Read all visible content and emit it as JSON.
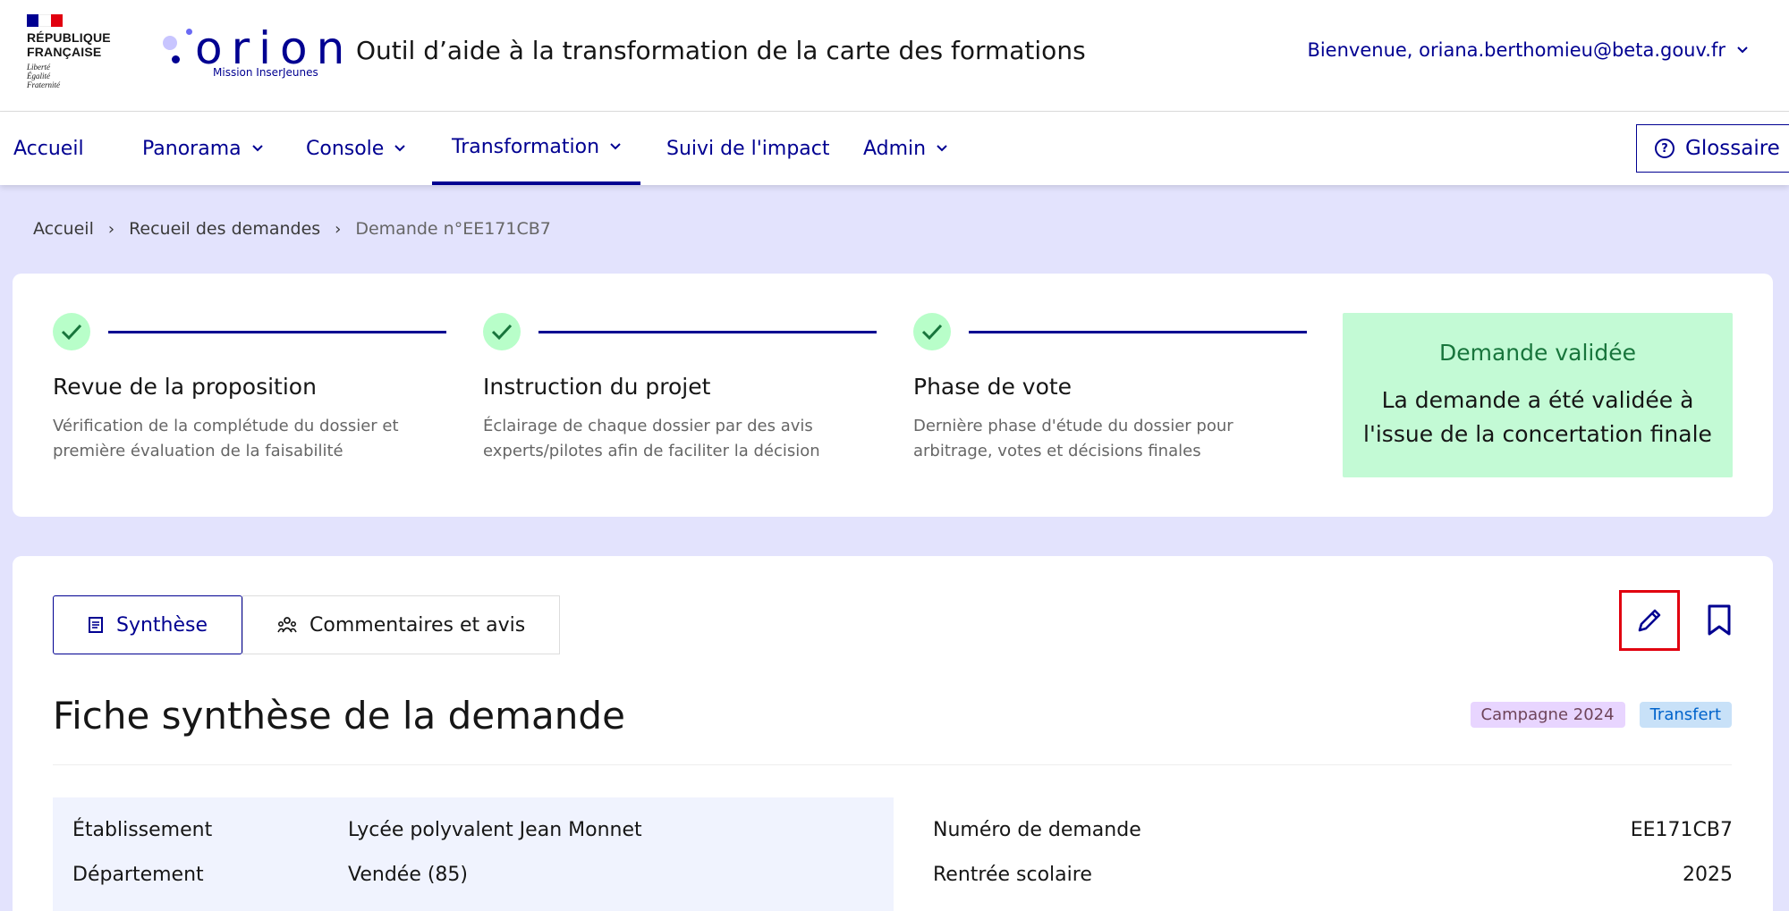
{
  "header": {
    "rf_text": [
      "RÉPUBLIQUE",
      "FRANÇAISE"
    ],
    "rf_motto": [
      "Liberté",
      "Égalité",
      "Fraternité"
    ],
    "logo_word": "orion",
    "logo_sub": "Mission InserJeunes",
    "app_title": "Outil d’aide à la transformation de la carte des formations",
    "welcome": "Bienvenue, oriana.berthomieu@beta.gouv.fr",
    "flag_colors": [
      "#000091",
      "#ffffff",
      "#e1000f"
    ]
  },
  "nav": {
    "items": [
      {
        "label": "Accueil",
        "dropdown": false
      },
      {
        "label": "Panorama",
        "dropdown": true
      },
      {
        "label": "Console",
        "dropdown": true
      },
      {
        "label": "Transformation",
        "dropdown": true,
        "active": true
      },
      {
        "label": "Suivi de l'impact",
        "dropdown": false
      },
      {
        "label": "Admin",
        "dropdown": true
      }
    ],
    "glossaire": "Glossaire"
  },
  "breadcrumb": [
    "Accueil",
    "Recueil des demandes",
    "Demande n°EE171CB7"
  ],
  "steps": [
    {
      "title": "Revue de la proposition",
      "desc": [
        "Vérification de la complétude du dossier et",
        "première évaluation de la faisabilité"
      ]
    },
    {
      "title": "Instruction du projet",
      "desc": [
        "Éclairage de chaque dossier par des avis",
        "experts/pilotes afin de faciliter la décision"
      ]
    },
    {
      "title": "Phase de vote",
      "desc": [
        "Dernière phase d'étude du dossier pour",
        "arbitrage, votes et décisions finales"
      ]
    }
  ],
  "status": {
    "title": "Demande validée",
    "text": [
      "La demande a été validée à",
      "l'issue de la concertation finale"
    ]
  },
  "tabs": [
    {
      "label": "Synthèse",
      "icon": "document-icon",
      "active": true
    },
    {
      "label": "Commentaires et avis",
      "icon": "people-icon",
      "active": false
    }
  ],
  "fiche": {
    "title": "Fiche synthèse de la demande",
    "badges": [
      "Campagne 2024",
      "Transfert"
    ]
  },
  "info_left": [
    {
      "label": "Établissement",
      "value": "Lycée polyvalent Jean Monnet"
    },
    {
      "label": "Département",
      "value": "Vendée (85)"
    }
  ],
  "info_right": [
    {
      "label": "Numéro de demande",
      "value": "EE171CB7"
    },
    {
      "label": "Rentrée scolaire",
      "value": "2025"
    }
  ]
}
